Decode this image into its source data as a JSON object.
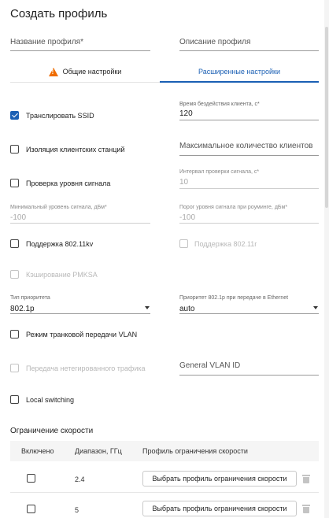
{
  "dialog": {
    "title": "Создать профиль"
  },
  "top_fields": {
    "profile_name": {
      "label": "Название профиля*"
    },
    "profile_description": {
      "label": "Описание профиля"
    }
  },
  "tabs": [
    {
      "label": "Общие настройки",
      "icon": "warning-icon",
      "active": false
    },
    {
      "label": "Расширенные настройки",
      "active": true
    }
  ],
  "left": {
    "broadcast_ssid": {
      "label": "Транслировать SSID",
      "checked": true
    },
    "client_isolation": {
      "label": "Изоляция клиентских станций",
      "checked": false
    },
    "signal_check": {
      "label": "Проверка уровня сигнала",
      "checked": false
    },
    "min_signal": {
      "label": "Минимальный уровень сигнала, дБм",
      "required_mark": "*",
      "value": "-100"
    },
    "support_80211kv": {
      "label": "Поддержка 802.11kv",
      "checked": false
    },
    "pmksa_caching": {
      "label": "Кэширование PMKSA",
      "checked": false,
      "disabled": true
    },
    "priority_type": {
      "label": "Тип приоритета",
      "value": "802.1p"
    },
    "vlan_trunk": {
      "label": "Режим транковой передачи VLAN",
      "checked": false
    },
    "untagged_traffic": {
      "label": "Передача нетегированного трафика",
      "checked": false,
      "disabled": true
    },
    "local_switching": {
      "label": "Local switching",
      "checked": false
    }
  },
  "right": {
    "idle_time": {
      "label": "Время бездействия клиента, с",
      "required_mark": "*",
      "value": "120"
    },
    "max_clients": {
      "placeholder": "Максимальное количество клиентов"
    },
    "signal_interval": {
      "label": "Интервал проверки сигнала, с",
      "required_mark": "*",
      "value": "10"
    },
    "roaming_threshold": {
      "label": "Порог уровня сигнала при роуминге, дБм",
      "required_mark": "*",
      "value": "-100"
    },
    "support_80211r": {
      "label": "Поддержка 802.11r",
      "checked": false,
      "disabled": true
    },
    "ethernet_priority": {
      "label": "Приоритет 802.1p при передаче в Ethernet",
      "value": "auto"
    },
    "general_vlan": {
      "placeholder": "General VLAN ID"
    }
  },
  "rate_limit": {
    "title": "Ограничение скорости",
    "columns": [
      "Включено",
      "Диапазон, ГГц",
      "Профиль ограничения скорости"
    ],
    "rows": [
      {
        "band": "2.4",
        "button_label": "Выбрать профиль ограничения скорости",
        "enabled": false
      },
      {
        "band": "5",
        "button_label": "Выбрать профиль ограничения скорости",
        "enabled": false
      }
    ]
  },
  "colors": {
    "accent": "#1a5fb4",
    "warning": "#ef6c00",
    "disabled": "#b8b8b8"
  }
}
